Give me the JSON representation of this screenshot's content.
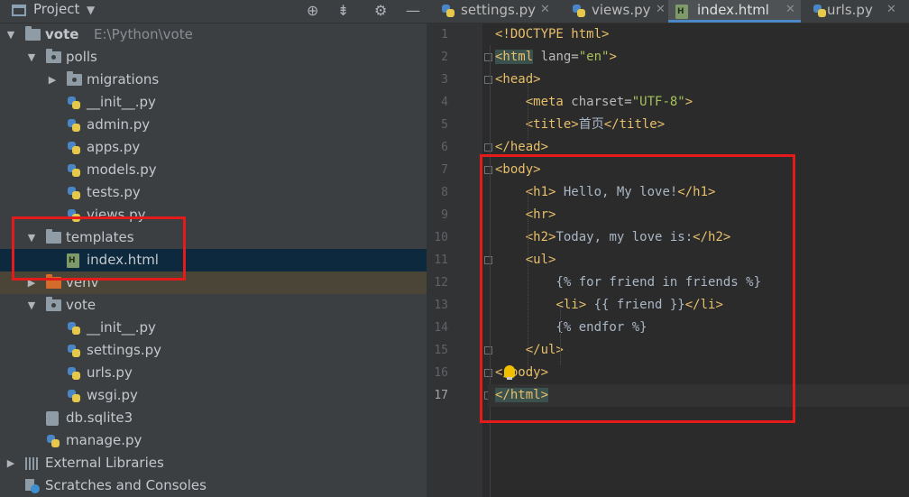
{
  "project_panel": {
    "title": "Project",
    "tree": [
      {
        "label": "vote",
        "sublabel": "E:\\Python\\vote",
        "icon": "folder-icon",
        "expanded": true
      },
      {
        "label": "polls",
        "icon": "package-folder-icon",
        "expanded": true
      },
      {
        "label": "migrations",
        "icon": "package-folder-icon",
        "expanded": false
      },
      {
        "label": "__init__.py",
        "icon": "python-file-icon"
      },
      {
        "label": "admin.py",
        "icon": "python-file-icon"
      },
      {
        "label": "apps.py",
        "icon": "python-file-icon"
      },
      {
        "label": "models.py",
        "icon": "python-file-icon"
      },
      {
        "label": "tests.py",
        "icon": "python-file-icon"
      },
      {
        "label": "views.py",
        "icon": "python-file-icon"
      },
      {
        "label": "templates",
        "icon": "folder-icon",
        "expanded": true
      },
      {
        "label": "index.html",
        "icon": "html-file-icon",
        "selected": true
      },
      {
        "label": "venv",
        "icon": "excluded-folder-icon",
        "expanded": false
      },
      {
        "label": "vote",
        "icon": "package-folder-icon",
        "expanded": true
      },
      {
        "label": "__init__.py",
        "icon": "python-file-icon"
      },
      {
        "label": "settings.py",
        "icon": "python-file-icon"
      },
      {
        "label": "urls.py",
        "icon": "python-file-icon"
      },
      {
        "label": "wsgi.py",
        "icon": "python-file-icon"
      },
      {
        "label": "db.sqlite3",
        "icon": "database-file-icon"
      },
      {
        "label": "manage.py",
        "icon": "python-file-icon"
      },
      {
        "label": "External Libraries",
        "icon": "library-icon",
        "expanded": false
      },
      {
        "label": "Scratches and Consoles",
        "icon": "scratches-icon"
      }
    ]
  },
  "tabs": [
    {
      "label": "settings.py",
      "icon": "python-file-icon",
      "active": false
    },
    {
      "label": "views.py",
      "icon": "python-file-icon",
      "active": false
    },
    {
      "label": "index.html",
      "icon": "html-file-icon",
      "active": true
    },
    {
      "label": "urls.py",
      "icon": "python-file-icon",
      "active": false
    }
  ],
  "editor": {
    "current_line": 17,
    "lines": [
      [
        [
          "tag",
          "<!DOCTYPE html>"
        ]
      ],
      [
        [
          "tag",
          "<html"
        ],
        [
          "attr",
          " lang="
        ],
        [
          "str",
          "\"en\""
        ],
        [
          "tag",
          ">"
        ]
      ],
      [
        [
          "tag",
          "<head>"
        ]
      ],
      [
        [
          "txt",
          "    "
        ],
        [
          "tag",
          "<meta"
        ],
        [
          "attr",
          " charset="
        ],
        [
          "str",
          "\"UTF-8\""
        ],
        [
          "tag",
          ">"
        ]
      ],
      [
        [
          "txt",
          "    "
        ],
        [
          "tag",
          "<title>"
        ],
        [
          "txt",
          "首页"
        ],
        [
          "tag",
          "</title>"
        ]
      ],
      [
        [
          "tag",
          "</head>"
        ]
      ],
      [
        [
          "tag",
          "<body>"
        ]
      ],
      [
        [
          "txt",
          "    "
        ],
        [
          "tag",
          "<h1>"
        ],
        [
          "txt",
          " Hello, My love!"
        ],
        [
          "tag",
          "</h1>"
        ]
      ],
      [
        [
          "txt",
          "    "
        ],
        [
          "tag",
          "<hr>"
        ]
      ],
      [
        [
          "txt",
          "    "
        ],
        [
          "tag",
          "<h2>"
        ],
        [
          "txt",
          "Today, my love is:"
        ],
        [
          "tag",
          "</h2>"
        ]
      ],
      [
        [
          "txt",
          "    "
        ],
        [
          "tag",
          "<ul>"
        ]
      ],
      [
        [
          "txt",
          "        {% for friend in friends %}"
        ]
      ],
      [
        [
          "txt",
          "        "
        ],
        [
          "tag",
          "<li>"
        ],
        [
          "txt",
          " {{ friend }}"
        ],
        [
          "tag",
          "</li>"
        ]
      ],
      [
        [
          "txt",
          "        {% endfor %}"
        ]
      ],
      [
        [
          "txt",
          "    "
        ],
        [
          "tag",
          "</ul>"
        ]
      ],
      [
        [
          "tag",
          "</body>"
        ]
      ],
      [
        [
          "tag",
          "</html>"
        ]
      ]
    ]
  }
}
